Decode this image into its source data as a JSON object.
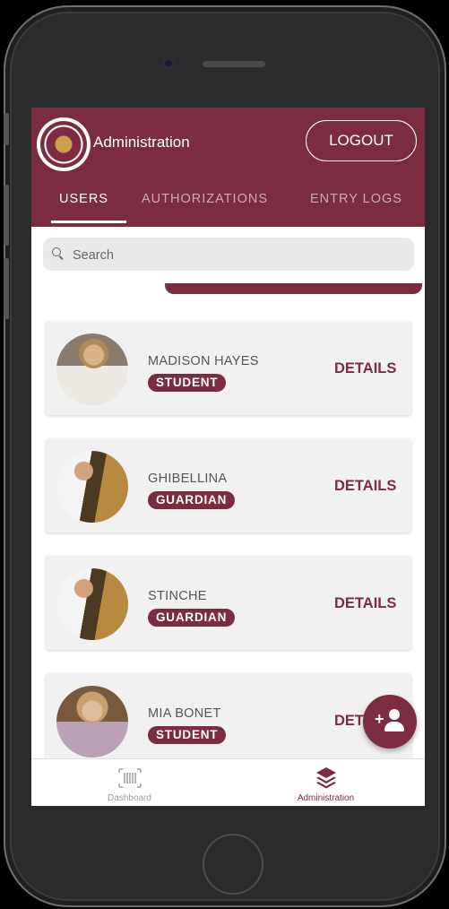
{
  "app": {
    "title": "Administration",
    "logout_label": "LOGOUT"
  },
  "tabs": [
    {
      "label": "USERS",
      "active": true
    },
    {
      "label": "AUTHORIZATIONS",
      "active": false
    },
    {
      "label": "ENTRY LOGS",
      "active": false
    }
  ],
  "search": {
    "placeholder": "Search",
    "value": ""
  },
  "users": [
    {
      "name": "MADISON HAYES",
      "role": "STUDENT",
      "action": "DETAILS"
    },
    {
      "name": "GHIBELLINA",
      "role": "GUARDIAN",
      "action": "DETAILS"
    },
    {
      "name": "STINCHE",
      "role": "GUARDIAN",
      "action": "DETAILS"
    },
    {
      "name": "MIA BONET",
      "role": "STUDENT",
      "action": "DETAILS"
    }
  ],
  "fab": {
    "icon": "add-person-icon",
    "plus": "+"
  },
  "bottom_nav": [
    {
      "label": "Dashboard",
      "icon": "barcode-icon",
      "active": false
    },
    {
      "label": "Administration",
      "icon": "layers-icon",
      "active": true
    }
  ],
  "colors": {
    "primary": "#7b2c40",
    "tab_inactive": "rgba(255,255,255,0.6)",
    "nav_inactive": "#9e9e9e"
  }
}
